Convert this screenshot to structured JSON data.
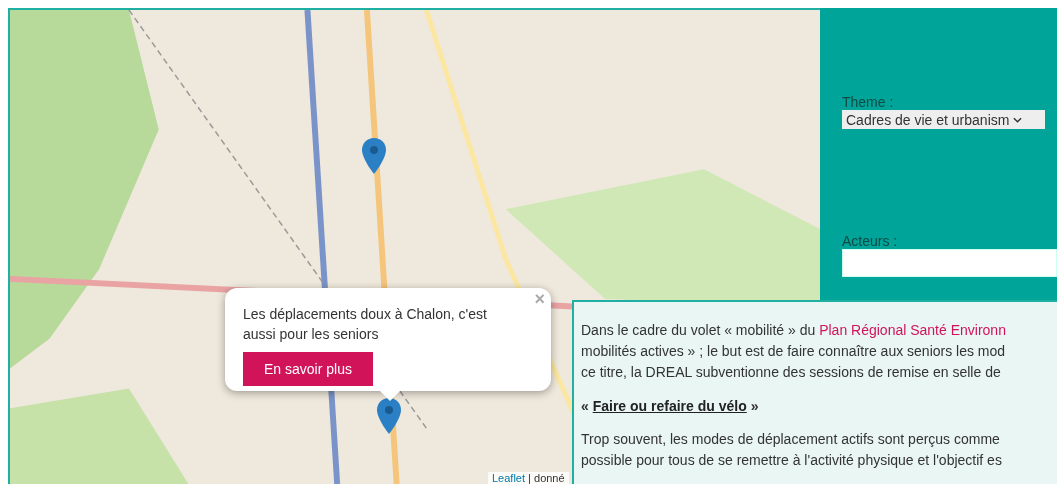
{
  "map": {
    "popup": {
      "text": "Les déplacements doux à Chalon, c'est aussi pour les seniors",
      "button": "En savoir plus",
      "close": "×"
    },
    "attribution": {
      "link": "Leaflet",
      "text": "| donné"
    }
  },
  "filters": [
    {
      "kind": "select",
      "label": "Theme :",
      "value": "Cadres de vie et urbanism"
    },
    {
      "kind": "input",
      "label": "Acteurs :"
    }
  ],
  "article": {
    "intro": {
      "lines": [
        "Dans le cadre du volet « mobilité » du ",
        "mobilités actives » ; le but est de faire connaître aux seniors les mod",
        "ce titre, la DREAL subventionne des sessions de remise en selle de"
      ],
      "link": "Plan Régional Santé Environn"
    },
    "heading": {
      "prefix": "« ",
      "link": "Faire ou refaire du vélo",
      "suffix": " »"
    },
    "body": [
      "Trop souvent, les modes de déplacement actifs sont perçus comme",
      "possible pour tous de se remettre à l'activité physique et l'objectif es"
    ]
  }
}
